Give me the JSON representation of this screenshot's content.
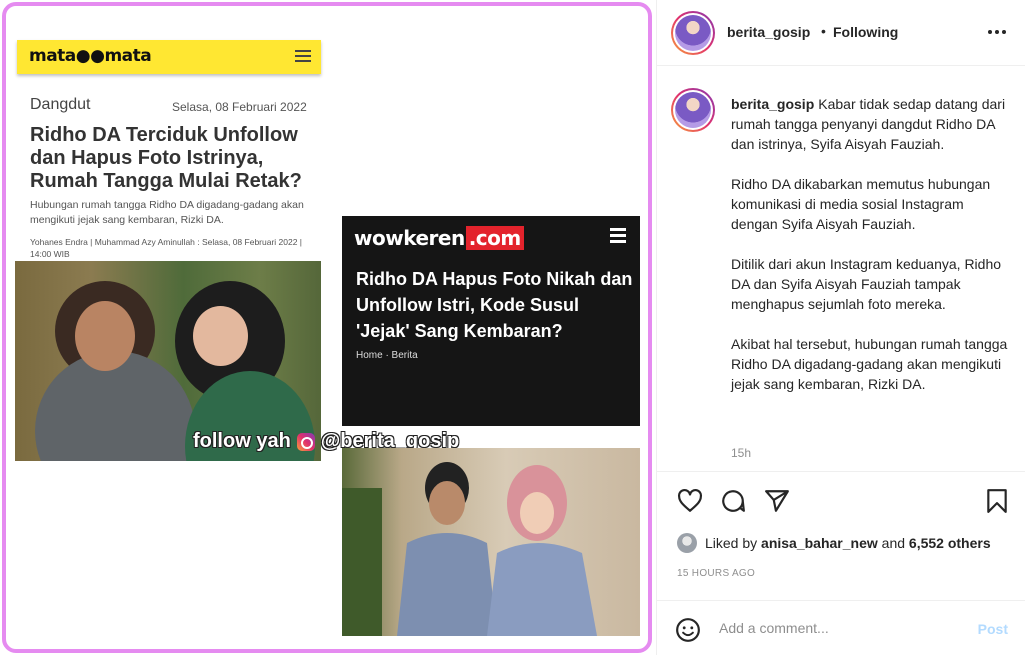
{
  "media": {
    "matamata": {
      "logo": "mata●●mata",
      "category": "Dangdut",
      "date": "Selasa, 08 Februari 2022",
      "title": "Ridho DA Terciduk Unfollow dan Hapus Foto Istrinya, Rumah Tangga Mulai Retak?",
      "summary": "Hubungan rumah tangga Ridho DA digadang-gadang akan mengikuti jejak sang kembaran, Rizki DA.",
      "byline": "Yohanes Endra | Muhammad Azy Aminullah : Selasa, 08 Februari 2022 | 14:00 WIB"
    },
    "watermark": {
      "left": "follow yah",
      "right": "@berita_gosip"
    },
    "wowkeren": {
      "logo_main": "wowkeren",
      "logo_suffix": ".com",
      "title": "Ridho DA Hapus Foto Nikah dan Unfollow Istri, Kode Susul 'Jejak' Sang Kembaran?",
      "breadcrumb": "Home · Berita"
    }
  },
  "header": {
    "username": "berita_gosip",
    "separator": "•",
    "follow_status": "Following"
  },
  "caption": {
    "username": "berita_gosip",
    "paragraphs": [
      "Kabar tidak sedap datang dari rumah tangga penyanyi dangdut Ridho DA dan istrinya, Syifa Aisyah Fauziah.",
      "Ridho DA dikabarkan memutus hubungan komunikasi di media sosial Instagram dengan Syifa Aisyah Fauziah.",
      "Ditilik dari akun Instagram keduanya, Ridho DA dan Syifa Aisyah Fauziah tampak menghapus sejumlah foto mereka.",
      "Akibat hal tersebut, hubungan rumah tangga Ridho DA digadang-gadang akan mengikuti jejak sang kembaran, Rizki DA."
    ],
    "time": "15h"
  },
  "actions": {
    "icons": [
      "heart-icon",
      "comment-icon",
      "share-icon",
      "bookmark-icon"
    ]
  },
  "likes": {
    "prefix": "Liked by",
    "user": "anisa_bahar_new",
    "middle": "and",
    "others": "6,552 others"
  },
  "post_time": "15 HOURS AGO",
  "comment": {
    "placeholder": "Add a comment...",
    "post_label": "Post"
  },
  "colors": {
    "frame_border": "#e58bf0",
    "matamata_yellow": "#ffe732",
    "wowkeren_red": "#e3232c",
    "post_button": "#b3dbff"
  }
}
